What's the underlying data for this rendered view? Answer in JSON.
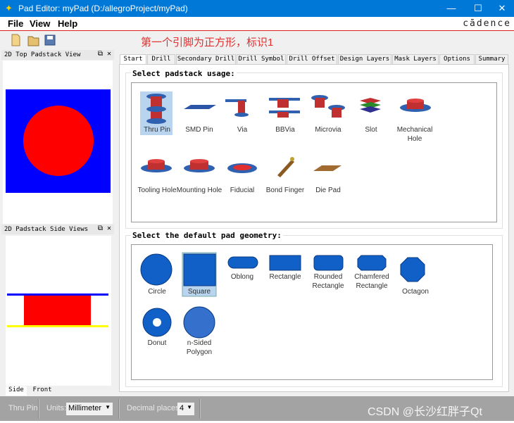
{
  "window": {
    "title": "Pad Editor: myPad  (D:/allegroProject/myPad)",
    "minimize": "—",
    "maximize": "☐",
    "close": "✕"
  },
  "menu": {
    "file": "File",
    "view": "View",
    "help": "Help",
    "brand": "cādence"
  },
  "toolbar": {
    "annotation": "第一个引脚为正方形，标识1",
    "icons": [
      "new-file-icon",
      "open-folder-icon",
      "save-icon"
    ]
  },
  "left": {
    "top_title": "2D Top Padstack View",
    "side_title": "2D Padstack Side Views",
    "tabs": [
      "Side",
      "Front"
    ],
    "colors": {
      "pad": "#ff0000",
      "bg": "#0000ff",
      "yellow": "#ffff00"
    }
  },
  "tabs": [
    "Start",
    "Drill",
    "Secondary Drill",
    "Drill Symbol",
    "Drill Offset",
    "Design Layers",
    "Mask Layers",
    "Options",
    "Summary"
  ],
  "usage": {
    "title": "Select padstack usage:",
    "items": [
      {
        "label": "Thru Pin",
        "selected": true
      },
      {
        "label": "SMD Pin"
      },
      {
        "label": "Via"
      },
      {
        "label": "BBVia"
      },
      {
        "label": "Microvia"
      },
      {
        "label": "Slot"
      },
      {
        "label": "Mechanical Hole"
      },
      {
        "label": "Tooling Hole"
      },
      {
        "label": "Mounting Hole"
      },
      {
        "label": "Fiducial"
      },
      {
        "label": "Bond Finger"
      },
      {
        "label": "Die Pad"
      }
    ]
  },
  "geometry": {
    "title": "Select the default pad geometry:",
    "items": [
      {
        "label": "Circle"
      },
      {
        "label": "Square",
        "selected": true
      },
      {
        "label": "Oblong"
      },
      {
        "label": "Rectangle"
      },
      {
        "label": "Rounded Rectangle"
      },
      {
        "label": "Chamfered Rectangle"
      },
      {
        "label": "Octagon"
      },
      {
        "label": "Donut"
      },
      {
        "label": "n-Sided Polygon"
      }
    ]
  },
  "status": {
    "usage": "Thru Pin",
    "units_label": "Units:",
    "units": "Millimeter",
    "decimal_label": "Decimal places:",
    "decimal": "4",
    "watermark": "CSDN @长沙红胖子Qt"
  }
}
